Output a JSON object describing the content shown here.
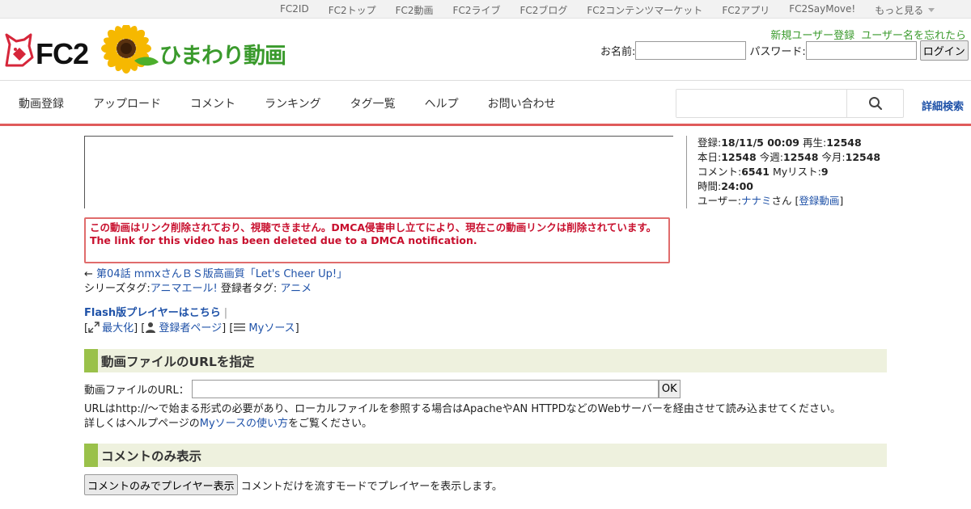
{
  "topbar": {
    "links": [
      "FC2ID",
      "FC2トップ",
      "FC2動画",
      "FC2ライブ",
      "FC2ブログ",
      "FC2コンテンツマーケット",
      "FC2アプリ",
      "FC2SayMove!"
    ],
    "more_label": "もっと見る"
  },
  "header": {
    "logo_fc2": "FC2",
    "logo_text": "ひまわり動画",
    "register_link": "新規ユーザー登録",
    "forgot_link": "ユーザー名を忘れたら",
    "name_label": "お名前:",
    "password_label": "パスワード:",
    "login_button": "ログイン"
  },
  "nav": {
    "items": [
      "動画登録",
      "アップロード",
      "コメント",
      "ランキング",
      "タグ一覧",
      "ヘルプ",
      "お問い合わせ"
    ],
    "search_placeholder": "",
    "advanced_search": "詳細検索"
  },
  "info": {
    "registered_label": "登録:",
    "registered_value": "18/11/5 00:09",
    "views_label": "再生:",
    "views_value": "12548",
    "today_label": "本日:",
    "today_value": "12548",
    "week_label": "今週:",
    "week_value": "12548",
    "month_label": "今月:",
    "month_value": "12548",
    "comment_label": "コメント:",
    "comment_value": "6541",
    "mylist_label": "Myリスト:",
    "mylist_value": "9",
    "time_label": "時間:",
    "time_value": "24:00",
    "user_label": "ユーザー:",
    "user_name": "ナナミ",
    "user_suffix": "さん",
    "user_videos_link": "登録動画"
  },
  "dmca": {
    "line_ja": "この動画はリンク削除されており、視聴できません。DMCA侵害申し立てにより、現在この動画リンクは削除されています。",
    "line_en": "The link for this video has been deleted due to a DMCA notification."
  },
  "episode": {
    "arrow": "←",
    "prev_link": "第04話 mmxさんＢＳ版高画質「Let's Cheer Up!」"
  },
  "tags": {
    "series_label": "シリーズタグ:",
    "series_tag": "アニマエール!",
    "registrant_label": "登録者タグ:",
    "registrant_tag": "アニメ"
  },
  "player_links": {
    "flash_link": "Flash版プレイヤーはこちら",
    "flash_sep": "|",
    "maximize": "最大化",
    "registrant_page": "登録者ページ",
    "my_source": "Myソース"
  },
  "url_section": {
    "title": "動画ファイルのURLを指定",
    "field_label": "動画ファイルのURL：",
    "url_value": "",
    "ok_button": "OK",
    "note_line1": "URLはhttp://～で始まる形式の必要があり、ローカルファイルを参照する場合はApacheやAN HTTPDなどのWebサーバーを経由させて読み込ませてください。",
    "note_line2_prefix": "詳しくはヘルプページの",
    "note_line2_link": "Myソースの使い方",
    "note_line2_suffix": "をご覧ください。"
  },
  "comment_section": {
    "title": "コメントのみ表示",
    "button": "コメントのみでプレイヤー表示",
    "description": "コメントだけを流すモードでプレイヤーを表示します。"
  }
}
